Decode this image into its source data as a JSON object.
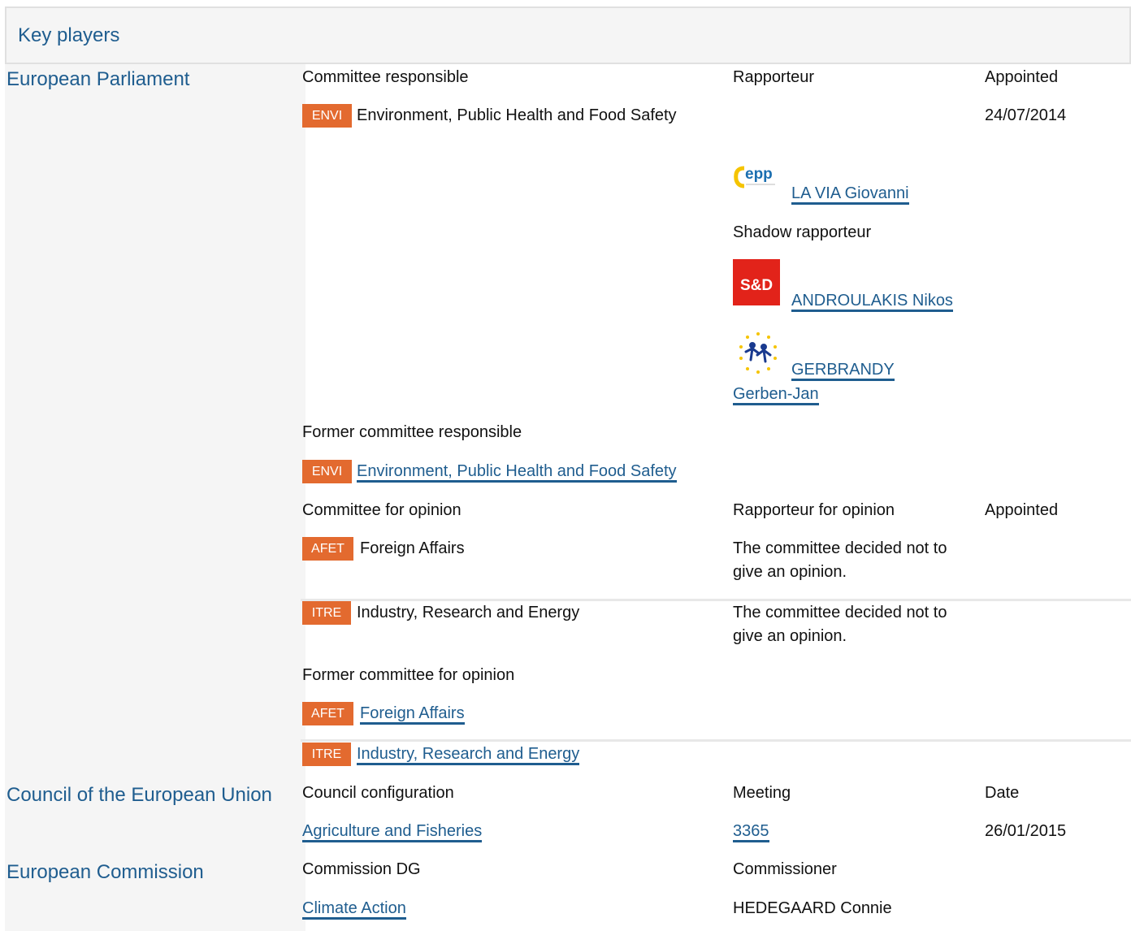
{
  "section_title": "Key players",
  "ep": {
    "title": "European Parliament",
    "committee_responsible": {
      "headers": [
        "Committee responsible",
        "Rapporteur",
        "Appointed"
      ],
      "committee": {
        "abbr": "ENVI",
        "name": "Environment, Public Health and Food Safety"
      },
      "appointed": "24/07/2014",
      "rapporteur": {
        "group": "EPP",
        "name": "LA VIA Giovanni"
      },
      "shadow_label": "Shadow rapporteur",
      "shadow": [
        {
          "group": "S&D",
          "name": "ANDROULAKIS Nikos"
        },
        {
          "group": "ALDE",
          "name_line1": "GERBRANDY",
          "name_line2": "Gerben-Jan"
        }
      ]
    },
    "former_committee_responsible": {
      "label": "Former committee responsible",
      "committee": {
        "abbr": "ENVI",
        "name": "Environment, Public Health and Food Safety"
      }
    },
    "committee_for_opinion": {
      "headers": [
        "Committee for opinion",
        "Rapporteur for opinion",
        "Appointed"
      ],
      "rows": [
        {
          "abbr": "AFET",
          "name": "Foreign Affairs",
          "rapporteur_line1": "The committee decided not to",
          "rapporteur_line2": "give an opinion."
        },
        {
          "abbr": "ITRE",
          "name": "Industry, Research and Energy",
          "rapporteur_line1": "The committee decided not to",
          "rapporteur_line2": "give an opinion."
        }
      ]
    },
    "former_committee_for_opinion": {
      "label": "Former committee for opinion",
      "rows": [
        {
          "abbr": "AFET",
          "name": "Foreign Affairs"
        },
        {
          "abbr": "ITRE",
          "name": "Industry, Research and Energy"
        }
      ]
    }
  },
  "council": {
    "title": "Council of the European Union",
    "headers": [
      "Council configuration",
      "Meeting",
      "Date"
    ],
    "configuration": "Agriculture and Fisheries",
    "meeting": "3365",
    "date": "26/01/2015"
  },
  "commission": {
    "title": "European Commission",
    "headers": [
      "Commission DG",
      "Commissioner"
    ],
    "dg": "Climate Action",
    "commissioner": "HEDEGAARD Connie"
  },
  "colors": {
    "accent_link": "#1f5d8f",
    "badge": "#e36a2f",
    "header_bg": "#f5f5f5",
    "border": "#e0e0e0",
    "epp_blue": "#1a6eb0",
    "epp_yellow": "#f5c400",
    "sd_red": "#e2231a"
  }
}
